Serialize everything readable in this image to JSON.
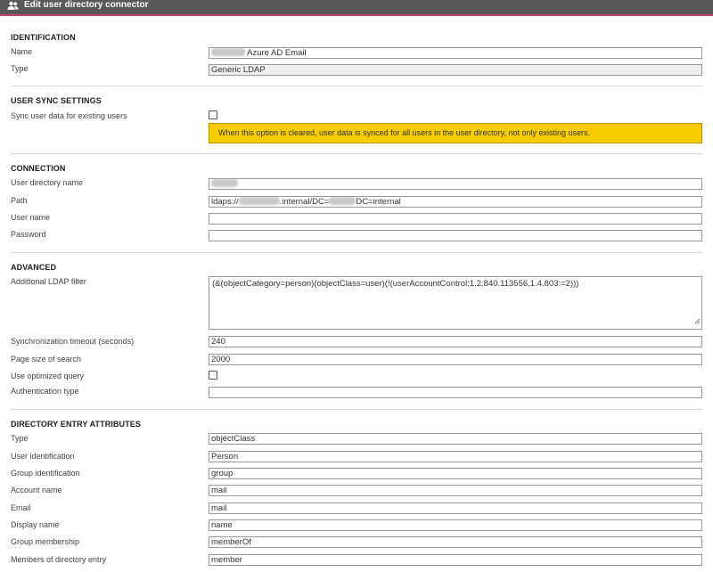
{
  "header": {
    "title": "Edit user directory connector",
    "icon": "users-icon"
  },
  "identification": {
    "section_title": "IDENTIFICATION",
    "name_label": "Name",
    "name_value": "Azure AD Email",
    "type_label": "Type",
    "type_value": "Generic LDAP"
  },
  "user_sync": {
    "section_title": "USER SYNC SETTINGS",
    "sync_label": "Sync user data for existing users",
    "sync_checked": false,
    "warning_text": "When this option is cleared, user data is synced for all users in the user directory, not only existing users.",
    "warning_color": "#f7cd00"
  },
  "connection": {
    "section_title": "CONNECTION",
    "directory_name_label": "User directory name",
    "directory_name_value": "",
    "path_label": "Path",
    "path_prefix": "ldaps://",
    "path_middle": ".internal/DC=",
    "path_suffix": "DC=internal",
    "username_label": "User name",
    "username_value": "",
    "password_label": "Password",
    "password_value": ""
  },
  "advanced": {
    "section_title": "ADVANCED",
    "ldap_filter_label": "Additional LDAP filter",
    "ldap_filter_value": "(&(objectCategory=person)(objectClass=user)(!(userAccountControl:1.2.840.113556.1.4.803:=2)))",
    "timeout_label": "Synchronization timeout (seconds)",
    "timeout_value": "240",
    "page_size_label": "Page size of search",
    "page_size_value": "2000",
    "optimized_label": "Use optimized query",
    "optimized_checked": false,
    "auth_type_label": "Authentication type",
    "auth_type_value": ""
  },
  "attributes": {
    "section_title": "DIRECTORY ENTRY ATTRIBUTES",
    "type_label": "Type",
    "type_value": "objectClass",
    "user_id_label": "User identification",
    "user_id_value": "Person",
    "group_id_label": "Group identification",
    "group_id_value": "group",
    "account_label": "Account name",
    "account_value": "mail",
    "email_label": "Email",
    "email_value": "mail",
    "display_label": "Display name",
    "display_value": "name",
    "membership_label": "Group membership",
    "membership_value": "memberOf",
    "members_label": "Members of directory entry",
    "members_value": "member"
  }
}
